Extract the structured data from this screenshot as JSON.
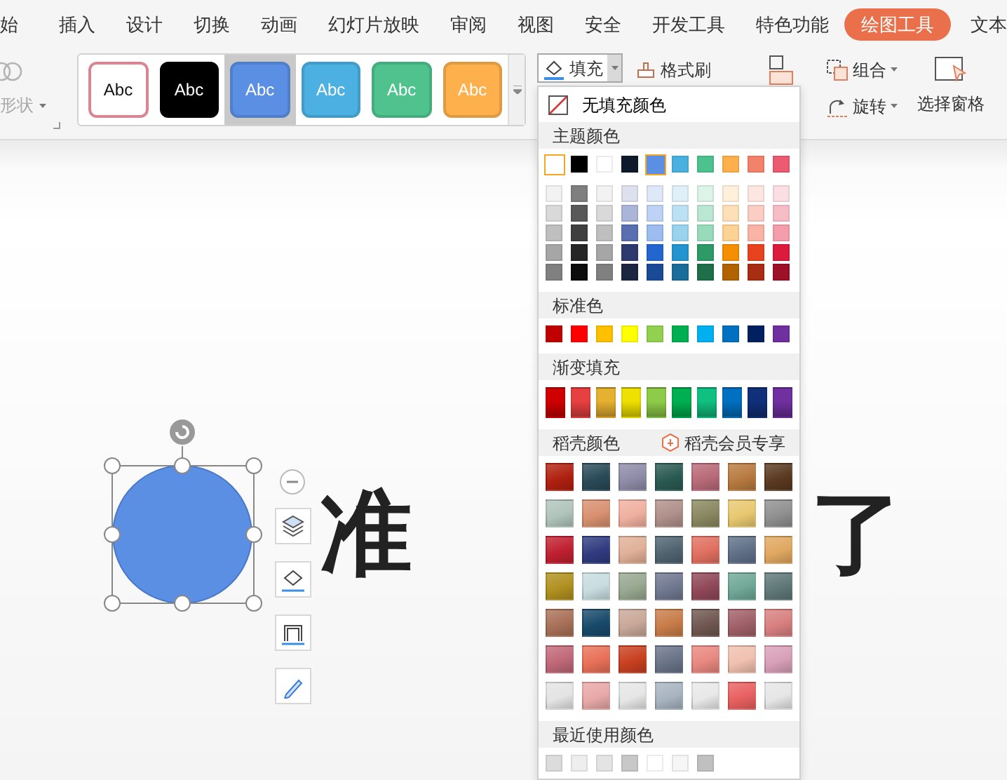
{
  "tabs": [
    {
      "label": "始",
      "selected": false
    },
    {
      "label": "插入",
      "selected": false
    },
    {
      "label": "设计",
      "selected": false
    },
    {
      "label": "切换",
      "selected": false
    },
    {
      "label": "动画",
      "selected": false
    },
    {
      "label": "幻灯片放映",
      "selected": false
    },
    {
      "label": "审阅",
      "selected": false
    },
    {
      "label": "视图",
      "selected": false
    },
    {
      "label": "安全",
      "selected": false
    },
    {
      "label": "开发工具",
      "selected": false
    },
    {
      "label": "特色功能",
      "selected": false
    },
    {
      "label": "绘图工具",
      "selected": true
    },
    {
      "label": "文本",
      "selected": false
    }
  ],
  "ribbon": {
    "merge_shape": {
      "label": "形状",
      "disabled": true
    },
    "styles": [
      {
        "label": "Abc",
        "color": "#ffffff",
        "selected": false
      },
      {
        "label": "Abc",
        "color": "#000000",
        "selected": false
      },
      {
        "label": "Abc",
        "color": "#5b8fe3",
        "selected": true
      },
      {
        "label": "Abc",
        "color": "#4cb0e2",
        "selected": false
      },
      {
        "label": "Abc",
        "color": "#4fc28e",
        "selected": false
      },
      {
        "label": "Abc",
        "color": "#fdb04c",
        "selected": false
      }
    ],
    "fill": {
      "label": "填充",
      "expanded": true
    },
    "format_painter": {
      "label": "格式刷"
    },
    "group": {
      "label": "组合"
    },
    "rotate": {
      "label": "旋转"
    },
    "selection_pane": {
      "label": "选择窗格"
    }
  },
  "fill_menu": {
    "no_fill": {
      "label": "无填充颜色"
    },
    "sections": [
      {
        "heading": "主题颜色",
        "kind": "flat",
        "rows": [
          {
            "kind": "base",
            "swatches": [
              {
                "color": "#ffffff",
                "selected": true
              },
              {
                "color": "#000000",
                "selected": false
              },
              {
                "color": "#ffffff",
                "selected": false
              },
              {
                "color": "#0e1a2b",
                "selected": false
              },
              {
                "color": "#5b8fe3",
                "selected": true
              },
              {
                "color": "#4ab0e0",
                "selected": false
              },
              {
                "color": "#4dc28e",
                "selected": false
              },
              {
                "color": "#fdb04c",
                "selected": false
              },
              {
                "color": "#f3826a",
                "selected": false
              },
              {
                "color": "#ec5b72",
                "selected": false
              }
            ]
          },
          {
            "kind": "tint",
            "swatches": [
              {
                "color": "#f2f2f2"
              },
              {
                "color": "#7f7f7f"
              },
              {
                "color": "#f2f2f2"
              },
              {
                "color": "#dde1ee"
              },
              {
                "color": "#dfe8f8"
              },
              {
                "color": "#dff0f9"
              },
              {
                "color": "#dcf3e8"
              },
              {
                "color": "#fff0dc"
              },
              {
                "color": "#fde6e1"
              },
              {
                "color": "#fbdee3"
              }
            ]
          },
          {
            "kind": "tint",
            "swatches": [
              {
                "color": "#d9d9d9"
              },
              {
                "color": "#595959"
              },
              {
                "color": "#d9d9d9"
              },
              {
                "color": "#aab5d8"
              },
              {
                "color": "#bed2f5"
              },
              {
                "color": "#bde1f4"
              },
              {
                "color": "#b9e7d2"
              },
              {
                "color": "#fee0b8"
              },
              {
                "color": "#fbcdc3"
              },
              {
                "color": "#f7bdc7"
              }
            ]
          },
          {
            "kind": "tint",
            "swatches": [
              {
                "color": "#bfbfbf"
              },
              {
                "color": "#3f3f3f"
              },
              {
                "color": "#bfbfbf"
              },
              {
                "color": "#5a6fb0"
              },
              {
                "color": "#9dbcf0"
              },
              {
                "color": "#9bd2ee"
              },
              {
                "color": "#97dbbb"
              },
              {
                "color": "#fed195"
              },
              {
                "color": "#f9b4a5"
              },
              {
                "color": "#f49dab"
              }
            ]
          },
          {
            "kind": "tint",
            "swatches": [
              {
                "color": "#a6a6a6"
              },
              {
                "color": "#262626"
              },
              {
                "color": "#a6a6a6"
              },
              {
                "color": "#2c3a6e"
              },
              {
                "color": "#2466d0"
              },
              {
                "color": "#2394cf"
              },
              {
                "color": "#2d9a68"
              },
              {
                "color": "#f58f00"
              },
              {
                "color": "#e8431f"
              },
              {
                "color": "#dc1a3c"
              }
            ]
          },
          {
            "kind": "tint",
            "swatches": [
              {
                "color": "#808080"
              },
              {
                "color": "#0d0d0d"
              },
              {
                "color": "#808080"
              },
              {
                "color": "#1d2640"
              },
              {
                "color": "#1a4a96"
              },
              {
                "color": "#1a6d98"
              },
              {
                "color": "#1e6e4a"
              },
              {
                "color": "#b06300"
              },
              {
                "color": "#a82d13"
              },
              {
                "color": "#9e1129"
              }
            ]
          }
        ]
      },
      {
        "heading": "标准色",
        "kind": "flat",
        "rows": [
          {
            "kind": "base",
            "swatches": [
              {
                "color": "#c00000"
              },
              {
                "color": "#ff0000"
              },
              {
                "color": "#ffc000"
              },
              {
                "color": "#ffff00"
              },
              {
                "color": "#92d050"
              },
              {
                "color": "#00b050"
              },
              {
                "color": "#00b0f0"
              },
              {
                "color": "#0070c0"
              },
              {
                "color": "#002060"
              },
              {
                "color": "#7030a0"
              }
            ]
          }
        ]
      },
      {
        "heading": "渐变填充",
        "kind": "gradient",
        "rows": [
          {
            "kind": "base",
            "swatches": [
              {
                "color": "#d00000"
              },
              {
                "color": "#e84040"
              },
              {
                "color": "#e6b030"
              },
              {
                "color": "#f0e000"
              },
              {
                "color": "#8dcc48"
              },
              {
                "color": "#00b050"
              },
              {
                "color": "#10c080"
              },
              {
                "color": "#0070c0"
              },
              {
                "color": "#10307a"
              },
              {
                "color": "#7030a0"
              }
            ]
          }
        ]
      },
      {
        "heading": "稻壳颜色",
        "badge": "稻壳会员专享",
        "kind": "tile",
        "rows": [
          {
            "kind": "base",
            "swatches": [
              {
                "color": "#b02010"
              },
              {
                "color": "#2a4a58"
              },
              {
                "color": "#8e8ca8"
              },
              {
                "color": "#2a5a52"
              },
              {
                "color": "#b86a78"
              },
              {
                "color": "#b87a40"
              },
              {
                "color": "#5a3a20"
              }
            ]
          },
          {
            "kind": "base",
            "swatches": [
              {
                "color": "#b0c4bc"
              },
              {
                "color": "#d89070"
              },
              {
                "color": "#f0b0a0"
              },
              {
                "color": "#b0908a"
              },
              {
                "color": "#8a8860"
              },
              {
                "color": "#e8c870"
              },
              {
                "color": "#909090"
              }
            ]
          },
          {
            "kind": "base",
            "swatches": [
              {
                "color": "#c02030"
              },
              {
                "color": "#303c80"
              },
              {
                "color": "#e0b098"
              },
              {
                "color": "#506470"
              },
              {
                "color": "#e07060"
              },
              {
                "color": "#607088"
              },
              {
                "color": "#e0a860"
              }
            ]
          },
          {
            "kind": "base",
            "swatches": [
              {
                "color": "#b09020"
              },
              {
                "color": "#c8dce0"
              },
              {
                "color": "#98a890"
              },
              {
                "color": "#707890"
              },
              {
                "color": "#904858"
              },
              {
                "color": "#70a898"
              },
              {
                "color": "#607878"
              }
            ]
          },
          {
            "kind": "base",
            "swatches": [
              {
                "color": "#a87058"
              },
              {
                "color": "#184a6a"
              },
              {
                "color": "#c8a898"
              },
              {
                "color": "#c87c48"
              },
              {
                "color": "#705850"
              },
              {
                "color": "#a06068"
              },
              {
                "color": "#d88080"
              }
            ]
          },
          {
            "kind": "base",
            "swatches": [
              {
                "color": "#c06878"
              },
              {
                "color": "#e87058"
              },
              {
                "color": "#c84020"
              },
              {
                "color": "#6a7488"
              },
              {
                "color": "#e88880"
              },
              {
                "color": "#f0c0b0"
              },
              {
                "color": "#d8a0b8"
              }
            ]
          },
          {
            "kind": "base",
            "swatches": [
              {
                "color": "#e4e4e4"
              },
              {
                "color": "#e8a8a8"
              },
              {
                "color": "#e6e6e6"
              },
              {
                "color": "#a8b4c0"
              },
              {
                "color": "#e8e8e8"
              },
              {
                "color": "#e86060"
              },
              {
                "color": "#e6e6e6"
              }
            ]
          }
        ]
      },
      {
        "heading": "最近使用颜色",
        "kind": "flat",
        "rows": [
          {
            "kind": "base",
            "swatches": [
              {
                "color": "#dcdcdc"
              },
              {
                "color": "#eeeeee"
              },
              {
                "color": "#e4e4e4"
              },
              {
                "color": "#c8c8c8"
              },
              {
                "color": "#ffffff"
              },
              {
                "color": "#f6f6f6"
              },
              {
                "color": "#c0c0c0"
              }
            ]
          }
        ]
      }
    ]
  },
  "canvas": {
    "shape": {
      "kind": "ellipse",
      "color": "#5b8fe3",
      "selected": true
    },
    "texts": [
      {
        "text": "准"
      },
      {
        "text": "了"
      }
    ]
  }
}
